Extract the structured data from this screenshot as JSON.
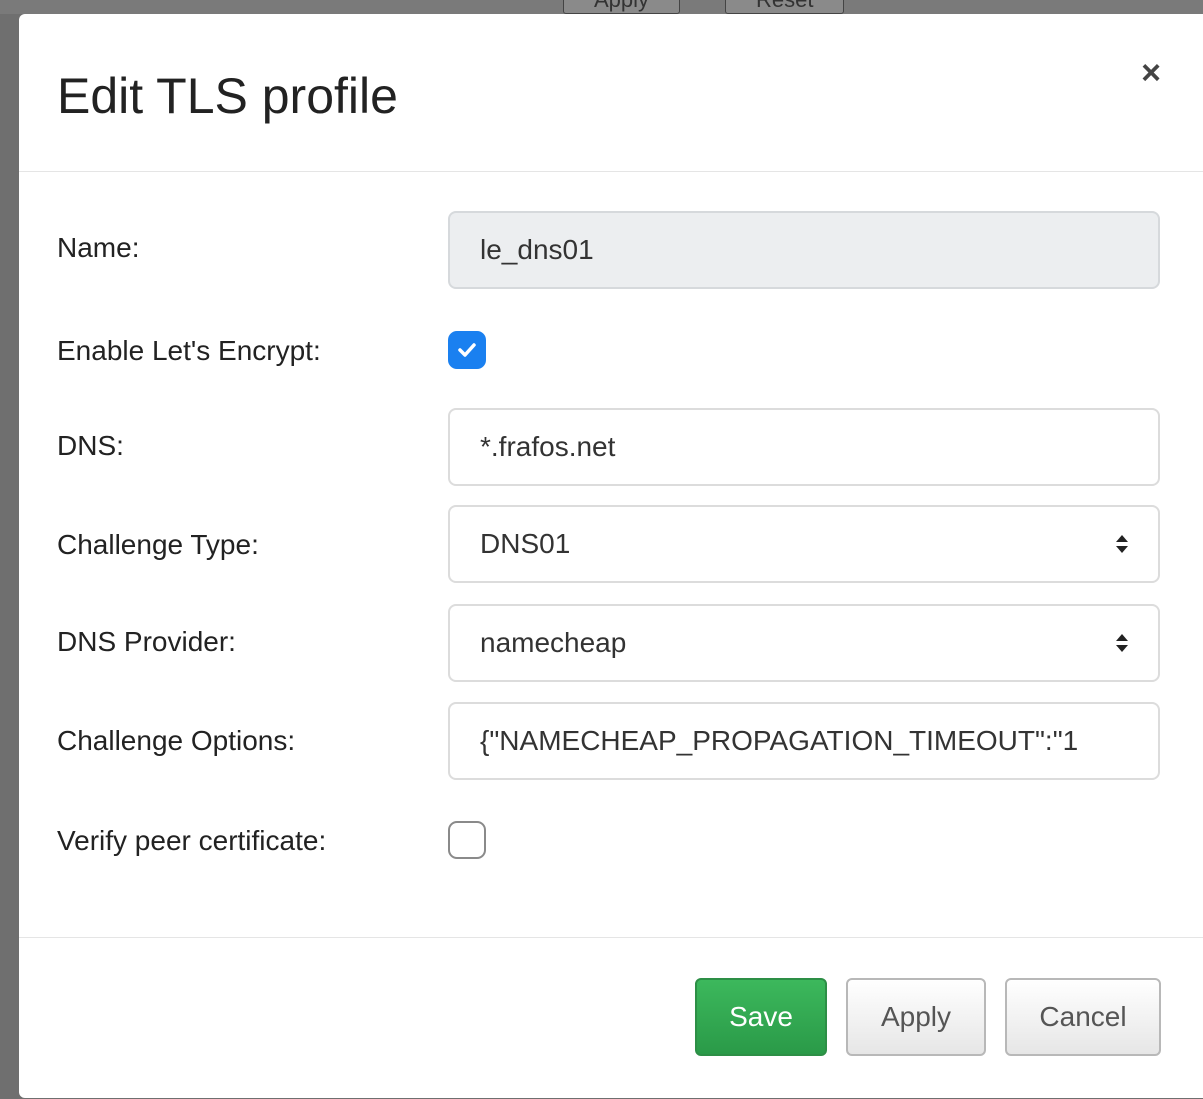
{
  "background": {
    "buttons": [
      {
        "label": "Apply"
      },
      {
        "label": "Reset"
      }
    ]
  },
  "modal": {
    "title": "Edit TLS profile",
    "close_label": "×",
    "fields": {
      "name": {
        "label": "Name:",
        "value": "le_dns01",
        "disabled": true
      },
      "enable_lets_encrypt": {
        "label": "Enable Let's Encrypt:",
        "checked": true
      },
      "dns": {
        "label": "DNS:",
        "value": "*.frafos.net"
      },
      "challenge_type": {
        "label": "Challenge Type:",
        "value": "DNS01"
      },
      "dns_provider": {
        "label": "DNS Provider:",
        "value": "namecheap"
      },
      "challenge_options": {
        "label": "Challenge Options:",
        "value": "{\"NAMECHEAP_PROPAGATION_TIMEOUT\":\"1"
      },
      "verify_peer_certificate": {
        "label": "Verify peer certificate:",
        "checked": false
      }
    },
    "footer": {
      "save_label": "Save",
      "apply_label": "Apply",
      "cancel_label": "Cancel"
    }
  },
  "colors": {
    "primary": "#1a80f0",
    "success": "#2a9a48",
    "backdrop": "#6f6f6f"
  },
  "icons": {
    "close": "close-icon",
    "select_arrow": "sort-arrows-icon",
    "check": "check-icon"
  }
}
